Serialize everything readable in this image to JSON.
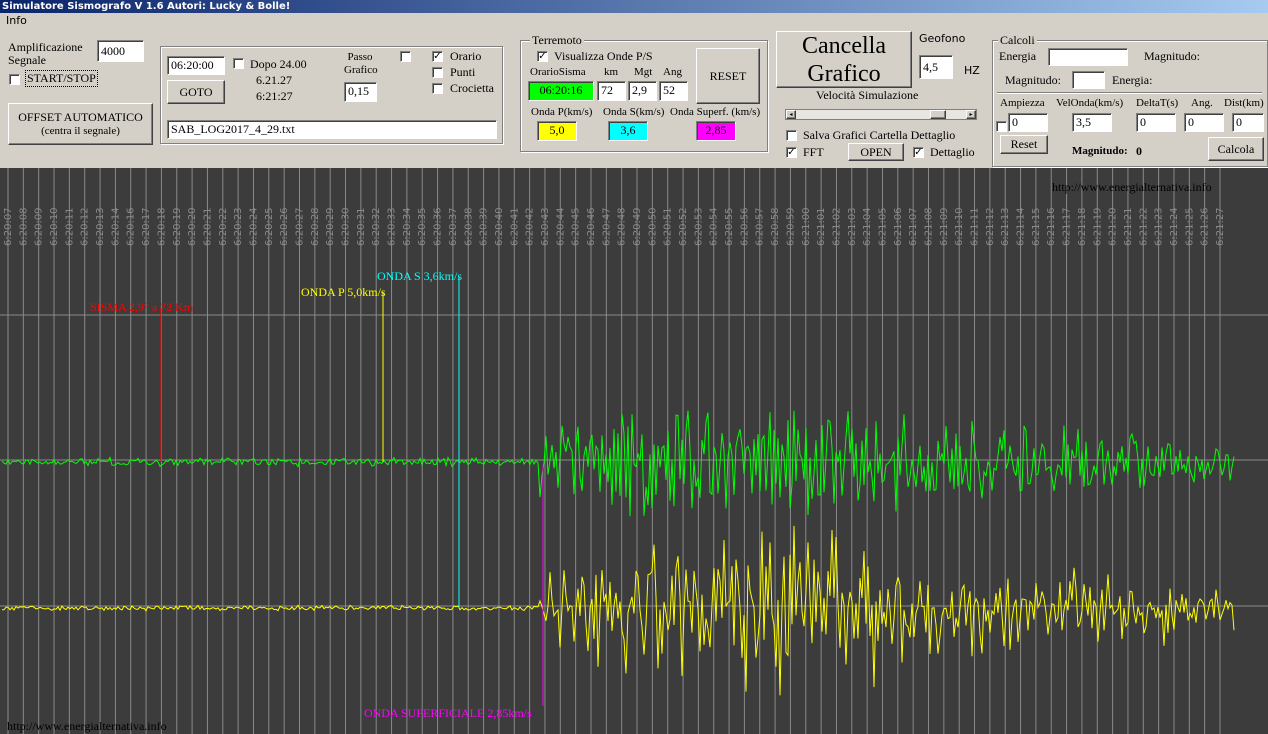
{
  "window": {
    "title": "Simulatore Sismografo V 1.6  Autori: Lucky & Bolle!"
  },
  "menu": {
    "info": "Info"
  },
  "amplification": {
    "label_line1": "Amplificazione",
    "label_line2": "Segnale",
    "value": "4000",
    "start_stop": "START/STOP",
    "start_stop_checked": false
  },
  "offset": {
    "line1": "OFFSET AUTOMATICO",
    "line2": "(centra il segnale)"
  },
  "time": {
    "value": "06:20:00",
    "goto": "GOTO",
    "dopo_label": "Dopo 24.00",
    "dopo_checked": false,
    "time1": "6.21.27",
    "time2": "6:21:27"
  },
  "passo": {
    "label_line1": "Passo",
    "label_line2": "Grafico",
    "value": "0,15",
    "extra_checked": false
  },
  "options": {
    "orario": "Orario",
    "orario_checked": true,
    "punti": "Punti",
    "punti_checked": false,
    "crocietta": "Crocietta",
    "crocietta_checked": false
  },
  "file": {
    "name": "SAB_LOG2017_4_29.txt"
  },
  "terremoto": {
    "title": "Terremoto",
    "visualizza": "Visualizza Onde P/S",
    "visualizza_checked": true,
    "headers": {
      "orario": "OrarioSisma",
      "km": "km",
      "mgt": "Mgt",
      "ang": "Ang"
    },
    "values": {
      "orario": "06:20:16",
      "km": "72",
      "mgt": "2,9",
      "ang": "52"
    },
    "reset": "RESET",
    "wave_labels": {
      "p": "Onda P(km/s)",
      "s": "Onda S(km/s)",
      "sup": "Onda Superf. (km/s)"
    },
    "wave_values": {
      "p": "5,0",
      "s": "3,6",
      "sup": "2,85"
    }
  },
  "cancella": {
    "line1": "Cancella",
    "line2": "Grafico"
  },
  "geofono": {
    "label": "Geofono",
    "value": "4,5",
    "unit": "HZ"
  },
  "velocita": {
    "label": "Velocità Simulazione",
    "level": 0.87
  },
  "salva": {
    "label": "Salva Grafici Cartella Dettaglio",
    "checked": false
  },
  "fft": {
    "label": "FFT",
    "checked": true,
    "open": "OPEN",
    "dettaglio": "Dettaglio",
    "dettaglio_checked": true
  },
  "calcoli": {
    "title": "Calcoli",
    "energia": "Energia",
    "energia_value": "",
    "magnitudo1": "Magnitudo:",
    "magnitudo2": "Magnitudo:",
    "magnitudo2_value": "",
    "energia2": "Energia:",
    "headers": {
      "ampiezza": "Ampiezza",
      "velonda": "VelOnda(km/s)",
      "deltat": "DeltaT(s)",
      "ang": "Ang.",
      "dist": "Dist(km)"
    },
    "values": {
      "ampiezza": "0",
      "velonda": "3,5",
      "deltat": "0",
      "ang": "0",
      "dist": "0"
    },
    "ampiezza_checked": false,
    "reset": "Reset",
    "magnitudo_result_label": "Magnitudo:",
    "magnitudo_result": "0",
    "calcola": "Calcola"
  },
  "plot": {
    "website_top": "http://www.energialternativa.info",
    "website_bottom": "http://www.energialternativa.info",
    "marker_sisma": "SISMA 2,9° a 72 Km",
    "marker_p": "ONDA P 5,0km/s",
    "marker_s": "ONDA S 3,6km/s",
    "marker_sup": "ONDA SUPERFICIALE 2,85km/s",
    "colors": {
      "background": "#3c3c3c",
      "grid": "#8a8a8a",
      "trace1": "#00ff00",
      "trace2": "#ffff00",
      "sisma": "#ff0000",
      "p": "#ffff00",
      "s": "#00ffff",
      "sup": "#ff00ff"
    },
    "time_labels": [
      "6:20:07",
      "6:20:08",
      "6:20:09",
      "6:20:10",
      "6:20:11",
      "6:20:12",
      "6:20:13",
      "6:20:14",
      "6:20:16",
      "6:20:17",
      "6:20:18",
      "6:20:19",
      "6:20:20",
      "6:20:21",
      "6:20:22",
      "6:20:23",
      "6:20:24",
      "6:20:25",
      "6:20:26",
      "6:20:27",
      "6:20:28",
      "6:20:29",
      "6:20:30",
      "6:20:31",
      "6:20:32",
      "6:20:33",
      "6:20:34",
      "6:20:35",
      "6:20:36",
      "6:20:37",
      "6:20:38",
      "6:20:39",
      "6:20:40",
      "6:20:41",
      "6:20:42",
      "6:20:43",
      "6:20:44",
      "6:20:45",
      "6:20:46",
      "6:20:47",
      "6:20:48",
      "6:20:49",
      "6:20:50",
      "6:20:51",
      "6:20:52",
      "6:20:53",
      "6:20:54",
      "6:20:55",
      "6:20:56",
      "6:20:57",
      "6:20:58",
      "6:20:59",
      "6:21:00",
      "6:21:01",
      "6:21:02",
      "6:21:03",
      "6:21:04",
      "6:21:05",
      "6:21:06",
      "6:21:07",
      "6:21:08",
      "6:21:09",
      "6:21:10",
      "6:21:11",
      "6:21:12",
      "6:21:13",
      "6:21:14",
      "6:21:15",
      "6:21:16",
      "6:21:17",
      "6:21:18",
      "6:21:19",
      "6:21:20",
      "6:21:21",
      "6:21:22",
      "6:21:23",
      "6:21:24",
      "6:21:25",
      "6:21:26",
      "6:21:27"
    ]
  }
}
